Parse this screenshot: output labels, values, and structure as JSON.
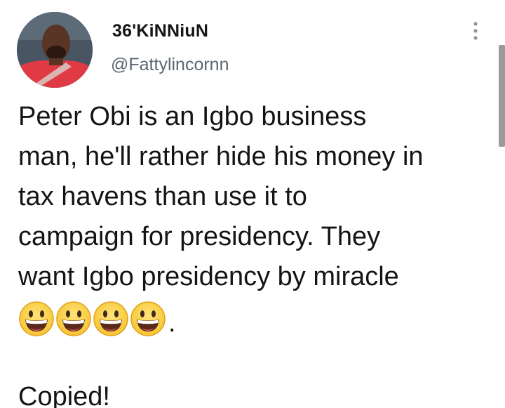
{
  "author": {
    "display_name": "36'KiNNiuN",
    "handle": "@Fattylincornn",
    "avatar_icon": "profile-photo-avatar"
  },
  "tweet": {
    "lines": [
      "Peter Obi is an Igbo business",
      "man, he'll rather hide his money in",
      "tax havens than use it to",
      "campaign for presidency. They",
      "want Igbo presidency by miracle"
    ],
    "emoji_count": 4,
    "emoji_icon": "grinning-face-emoji",
    "emoji_trailing": ".",
    "footer": "Copied!"
  },
  "menu_icon": "more-vertical-icon",
  "colors": {
    "text": "#141414",
    "handle": "#5b6670",
    "emoji_face": "#f7c531",
    "avatar_shirt": "#e03a44"
  }
}
